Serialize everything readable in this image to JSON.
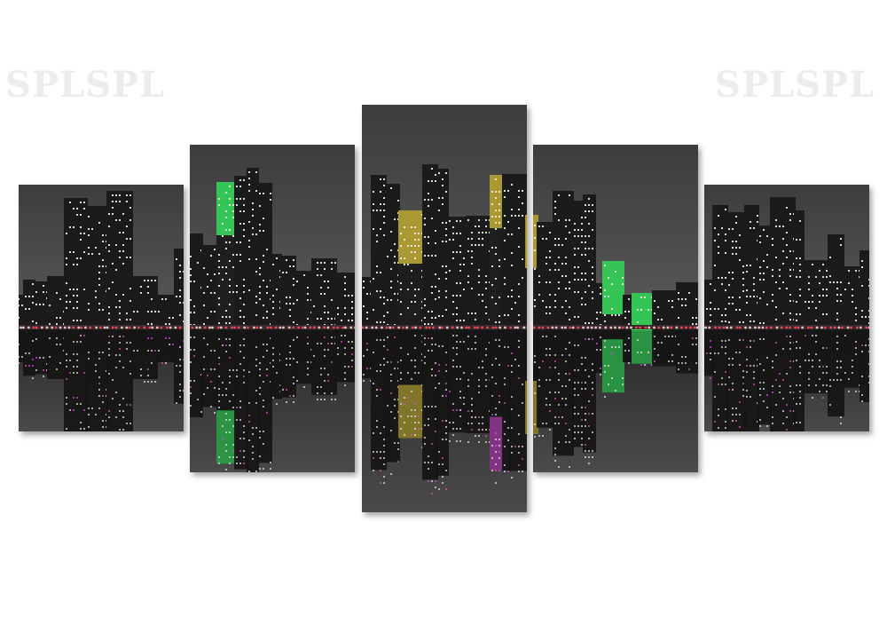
{
  "watermarks": [
    "SPLSPL",
    "SPLSPL"
  ],
  "artwork": {
    "subject": "night-city-skyline-with-water-reflection",
    "panel_count": 5,
    "colors": {
      "sky": "#5a5a5a",
      "water": "#4a4a4a",
      "green_accent": "#3dfc6a",
      "yellow_accent": "#d9c23a",
      "magenta_accent": "#d64fd8",
      "red_accent": "#ff4a5a"
    }
  }
}
